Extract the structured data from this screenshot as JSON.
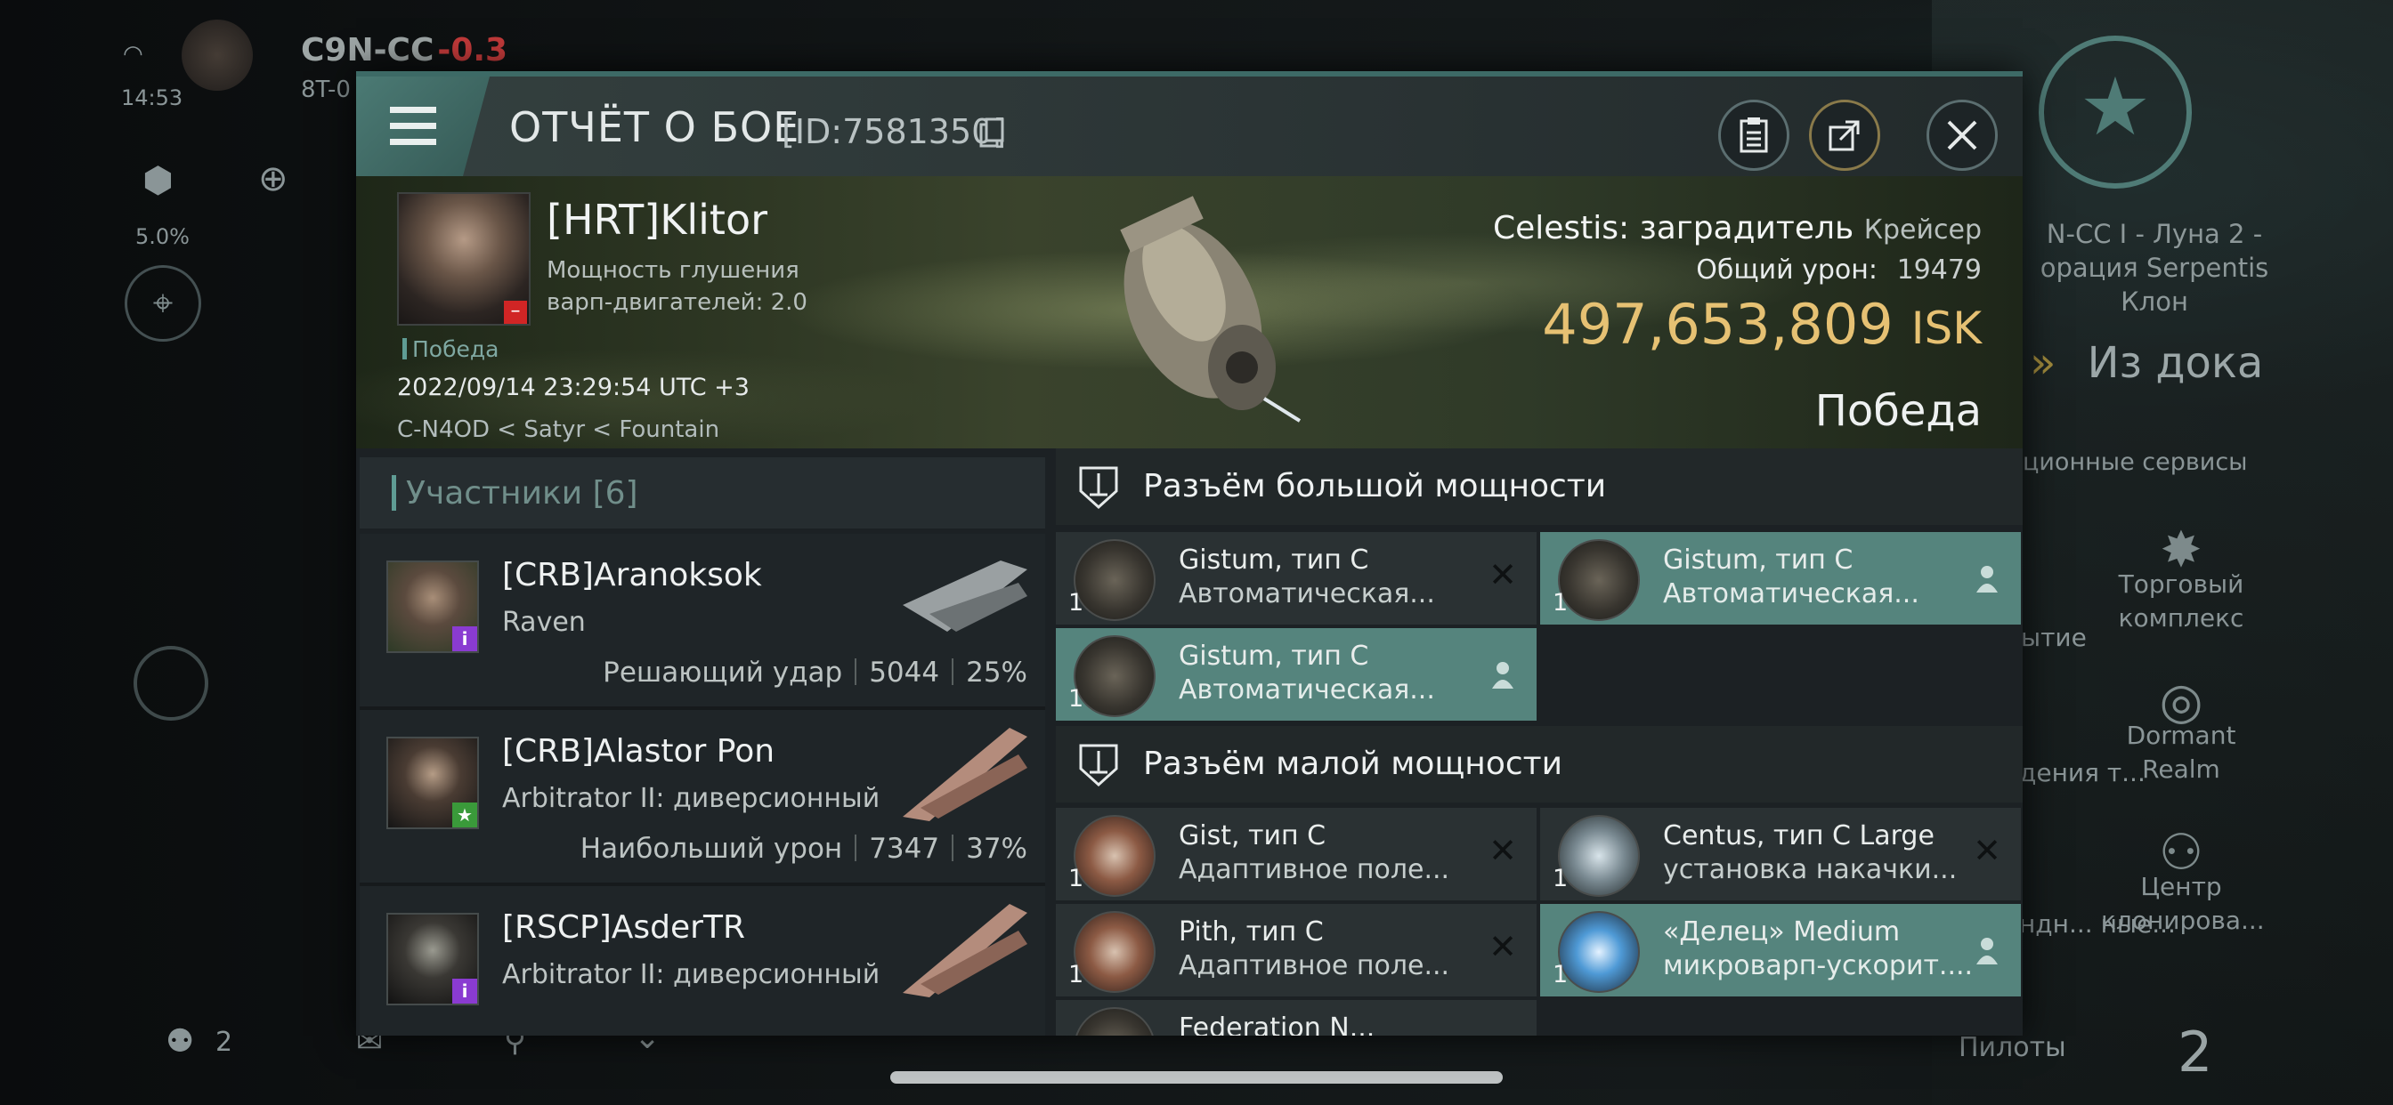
{
  "background": {
    "system_name": "C9N-CC",
    "security": "-0.3",
    "system_sub": "8T-0",
    "clock": "14:53",
    "percent": "5.0%",
    "right_location_lines": [
      "N-CC I - Луна 2 -",
      "орация Serpentis",
      "Клон"
    ],
    "undock_label": "Из дока",
    "services_label": "ционные сервисы",
    "services": [
      {
        "label": "ытие",
        "icon": "open-icon"
      },
      {
        "label": "Торговый комплекс",
        "icon": "market-icon"
      },
      {
        "label": "дения т...",
        "icon": "fitting-icon"
      },
      {
        "label": "Dormant Realm",
        "icon": "dormant-icon"
      },
      {
        "label": "ндн... ные...",
        "icon": "agency-icon"
      },
      {
        "label": "Центр клонирова...",
        "icon": "clone-icon"
      }
    ],
    "pilots_label": "Пилоты",
    "pilots_count": "2",
    "local_count": "2"
  },
  "header": {
    "title": "ОТЧЁТ О БОЕ",
    "report_id": "[ID:7581350]",
    "icons": [
      "menu-icon",
      "copy-icon",
      "clipboard-icon",
      "share-icon",
      "close-icon"
    ]
  },
  "victim": {
    "name": "[HRT]Klitor",
    "stat_line1": "Мощность глушения",
    "stat_line2": "варп-двигателей: 2.0",
    "result_small": "Победа",
    "datetime": "2022/09/14 23:29:54 UTC +3",
    "location": "C-N4OD < Satyr < Fountain",
    "ship_name": "Celestis: заградитель",
    "ship_class": "Крейсер",
    "damage_label": "Общий урон:",
    "damage_value": "19479",
    "isk_value": "497,653,809",
    "isk_unit": "ISK",
    "result_big": "Победа"
  },
  "participants": {
    "label": "Участники",
    "count": "[6]",
    "items": [
      {
        "name": "[CRB]Aranoksok",
        "ship": "Raven",
        "role": "Решающий удар",
        "damage": "5044",
        "percent": "25%",
        "badge": "i",
        "badge_color": "#8a3bd1"
      },
      {
        "name": "[CRB]Alastor Pon",
        "ship": "Arbitrator II: диверсионный",
        "role": "Наибольший урон",
        "damage": "7347",
        "percent": "37%",
        "badge": "★",
        "badge_color": "#3a9a3a"
      },
      {
        "name": "[RSCP]AsderTR",
        "ship": "Arbitrator II: диверсионный",
        "role": "",
        "damage": "",
        "percent": "",
        "badge": "i",
        "badge_color": "#8a3bd1"
      }
    ]
  },
  "high_slots": {
    "label": "Разъём большой мощности",
    "items": [
      {
        "line1": "Gistum, тип C",
        "line2": "Автоматическая...",
        "qty": "1",
        "state": "destroyed"
      },
      {
        "line1": "Gistum, тип C",
        "line2": "Автоматическая...",
        "qty": "1",
        "state": "dropped"
      },
      {
        "line1": "Gistum, тип C",
        "line2": "Автоматическая...",
        "qty": "1",
        "state": "dropped"
      }
    ]
  },
  "low_slots": {
    "label": "Разъём малой мощности",
    "items": [
      {
        "line1": "Gist, тип C",
        "line2": "Адаптивное поле...",
        "qty": "1",
        "state": "destroyed"
      },
      {
        "line1": "Centus, тип C Large",
        "line2": "установка накачки...",
        "qty": "1",
        "state": "destroyed"
      },
      {
        "line1": "Pith, тип C",
        "line2": "Адаптивное поле...",
        "qty": "1",
        "state": "destroyed"
      },
      {
        "line1": "«Делец» Medium",
        "line2": "микроварп-ускорит....",
        "qty": "1",
        "state": "dropped"
      },
      {
        "line1": "Federation N...",
        "line2": "",
        "qty": "",
        "state": "destroyed"
      }
    ]
  },
  "colors": {
    "accent": "#5f9c94",
    "isk": "#e6c173",
    "dropped_bg": "#55847d",
    "destroyed_bg": "#2a3133"
  }
}
